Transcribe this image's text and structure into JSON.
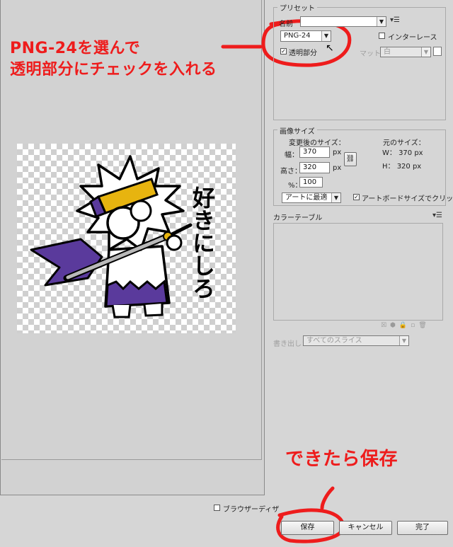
{
  "annotations": {
    "line1": "PNG-24を選んで",
    "line2": "透明部分にチェックを入れる",
    "save_note": "できたら保存"
  },
  "preset": {
    "legend": "プリセット",
    "name_label": "名前",
    "format_value": "PNG-24",
    "interlace_label": "インターレース",
    "transparency_label": "透明部分",
    "matte_label": "マット",
    "matte_value": "白"
  },
  "image_size": {
    "legend": "画像サイズ",
    "new_size_label": "変更後のサイズ：",
    "orig_size_label": "元のサイズ：",
    "width_label": "幅：",
    "height_label": "高さ：",
    "percent_label": "%：",
    "width_value": "370",
    "height_value": "320",
    "percent_value": "100",
    "px": "px",
    "orig_w": "W： 370 px",
    "orig_h": "H： 320 px",
    "resample_value": "アートに最適",
    "clip_label": "アートボードサイズでクリップ"
  },
  "color_table": {
    "title": "カラーテーブル"
  },
  "export": {
    "label": "書き出し：",
    "value": "すべてのスライス"
  },
  "preview": {
    "browser_dither_label": "ブラウザーディザ"
  },
  "buttons": {
    "save": "保存",
    "cancel": "キャンセル",
    "done": "完了"
  },
  "artwork": {
    "handwriting": "好きにしろ"
  },
  "colors": {
    "accent_red": "#ee1c1c",
    "purple": "#5a3a9c",
    "gold": "#e7b40f"
  }
}
